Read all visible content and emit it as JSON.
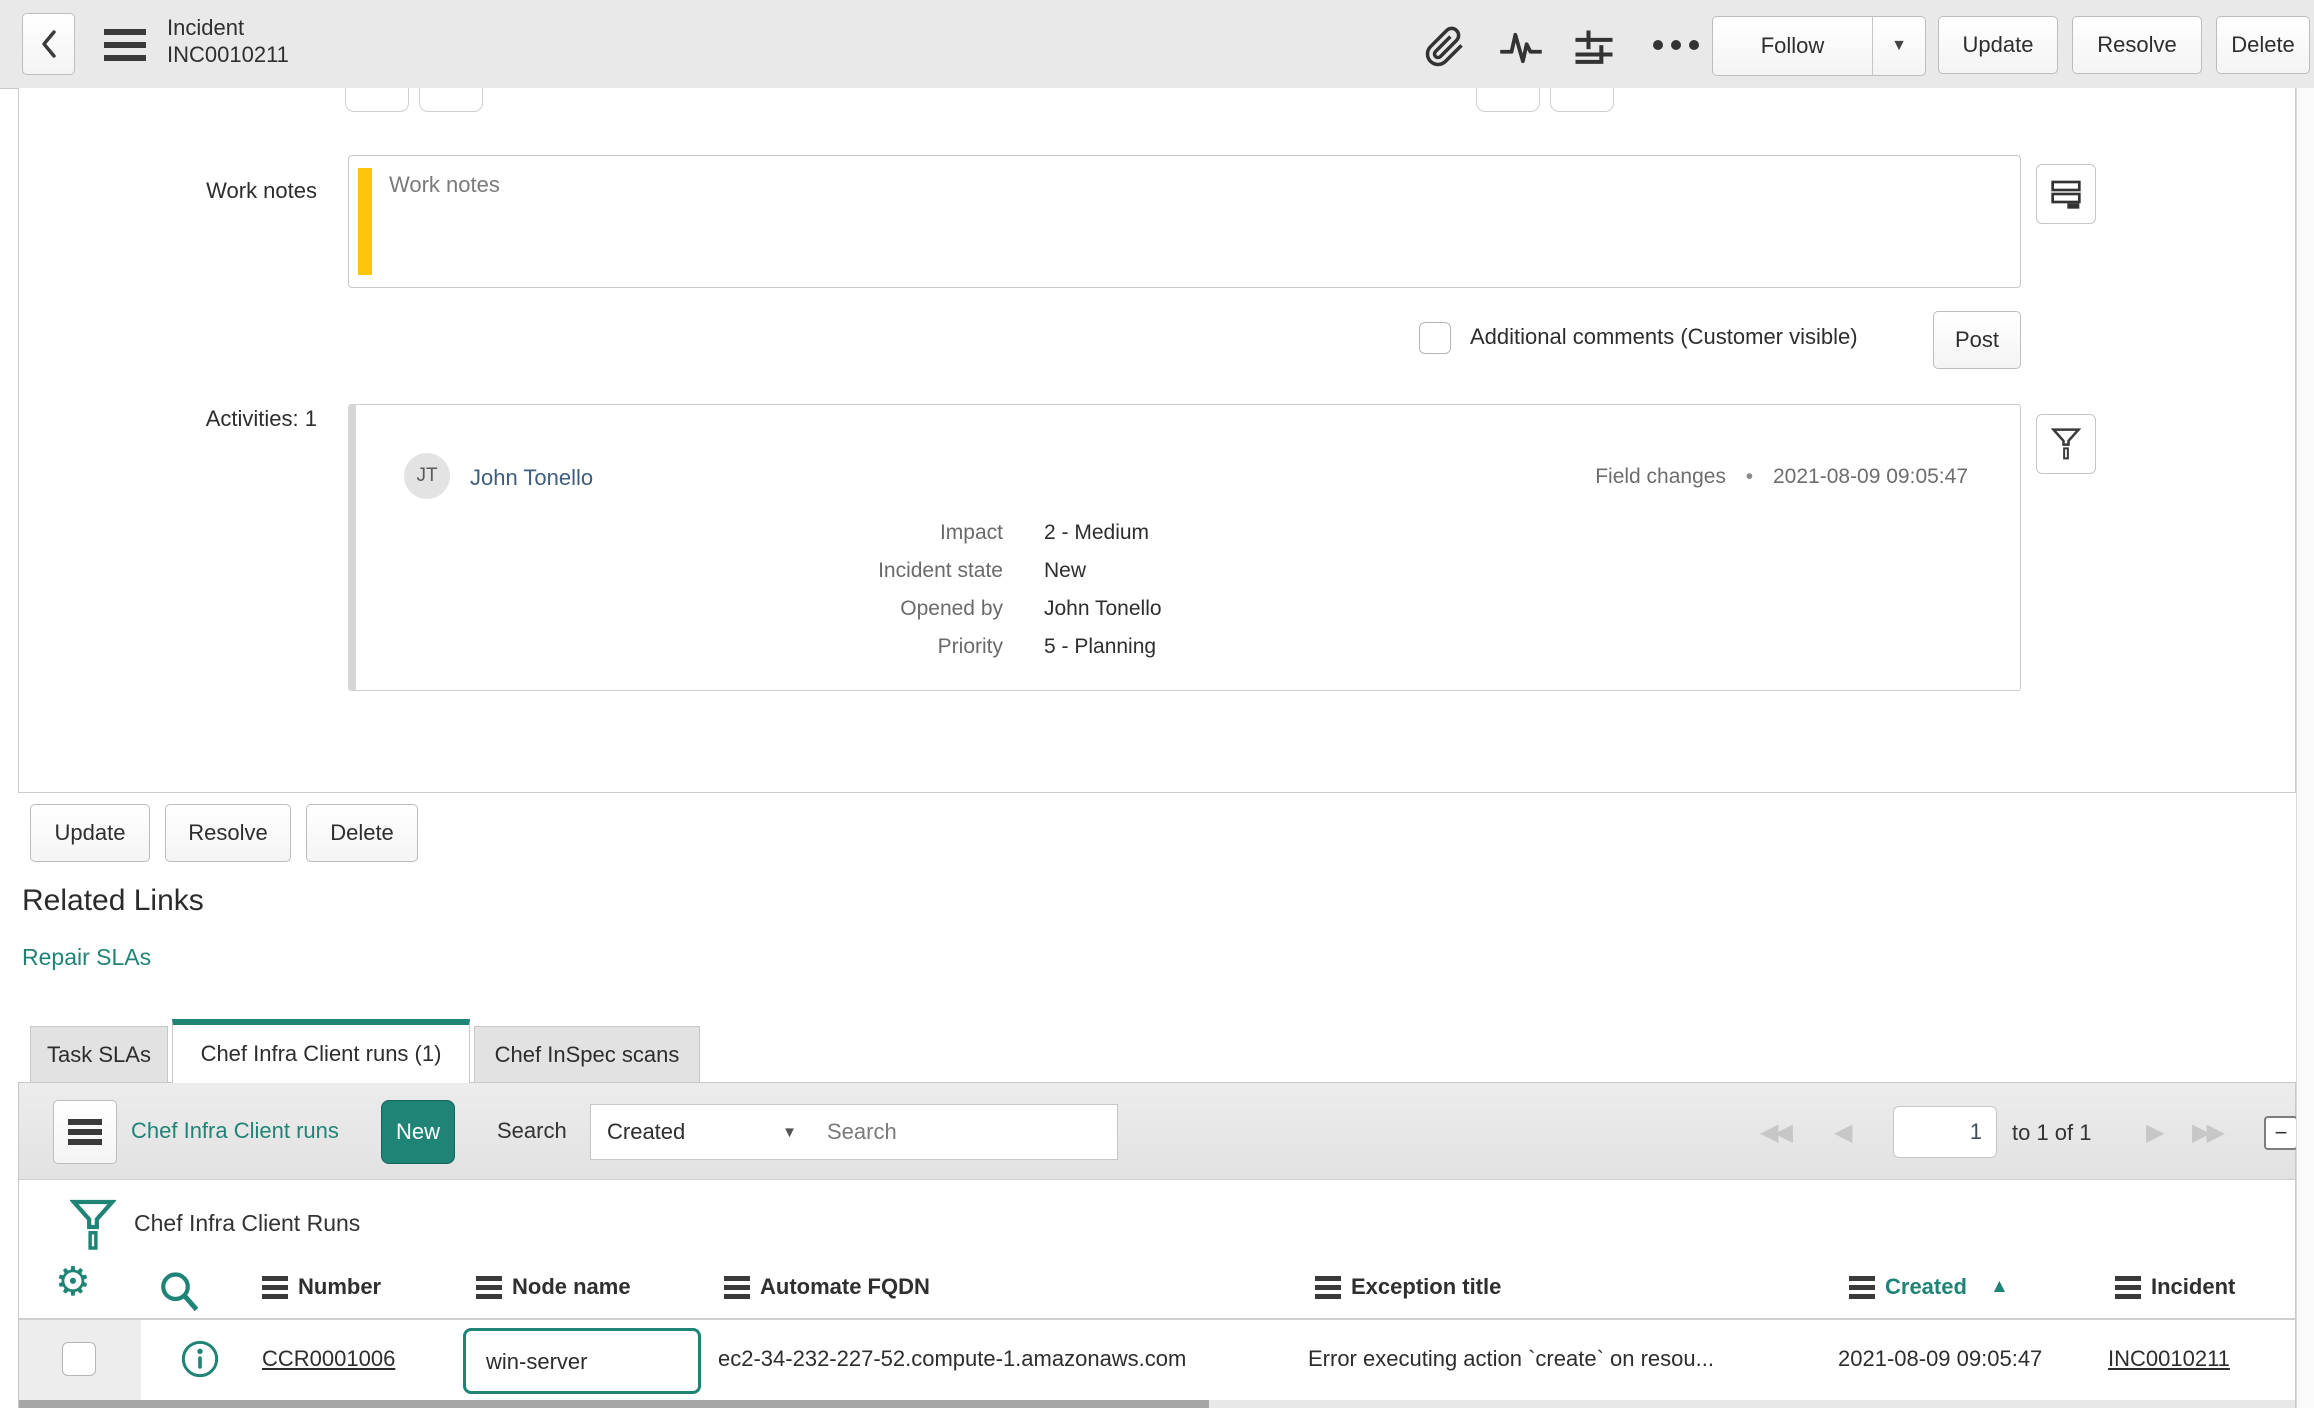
{
  "colors": {
    "accent_teal": "#1f8476",
    "work_notes_bar": "#ffc40c"
  },
  "icons": {
    "gear": "⚙",
    "caret_down": "▼",
    "sort_asc": "▲",
    "bullet": "•",
    "minus": "−",
    "first_page": "◀◀",
    "prev_page": "◀",
    "next_page": "▶",
    "last_page": "▶▶"
  },
  "header": {
    "title_line1": "Incident",
    "title_line2": "INC0010211",
    "follow_label": "Follow",
    "update_label": "Update",
    "resolve_label": "Resolve",
    "delete_label": "Delete"
  },
  "form": {
    "work_notes_label": "Work notes",
    "work_notes_placeholder": "Work notes",
    "additional_comments_label": "Additional comments (Customer visible)",
    "post_label": "Post",
    "activities_label": "Activities: 1",
    "activity": {
      "avatar_initials": "JT",
      "author": "John Tonello",
      "type": "Field changes",
      "timestamp": "2021-08-09 09:05:47",
      "fields": [
        {
          "label": "Impact",
          "value": "2 - Medium"
        },
        {
          "label": "Incident state",
          "value": "New"
        },
        {
          "label": "Opened by",
          "value": "John Tonello"
        },
        {
          "label": "Priority",
          "value": "5 - Planning"
        }
      ]
    }
  },
  "footer_buttons": {
    "update_label": "Update",
    "resolve_label": "Resolve",
    "delete_label": "Delete"
  },
  "related_links": {
    "title": "Related Links",
    "repair_slas": "Repair SLAs"
  },
  "tabs": [
    {
      "label": "Task SLAs"
    },
    {
      "label": "Chef Infra Client runs (1)"
    },
    {
      "label": "Chef InSpec scans"
    }
  ],
  "list": {
    "title_link": "Chef Infra Client runs",
    "new_button": "New",
    "search_label": "Search",
    "search_field_selected": "Created",
    "search_placeholder": "Search",
    "pagination": {
      "page": "1",
      "range": "to 1 of 1"
    },
    "breadcrumb_title": "Chef Infra Client Runs",
    "columns": [
      "Number",
      "Node name",
      "Automate FQDN",
      "Exception title",
      "Created",
      "Incident"
    ],
    "sorted_column": "Created",
    "rows": [
      {
        "number": "CCR0001006",
        "node_name": "win-server",
        "automate_fqdn": "ec2-34-232-227-52.compute-1.amazonaws.com",
        "exception_title": "Error executing action `create` on resou...",
        "created": "2021-08-09 09:05:47",
        "incident": "INC0010211"
      }
    ]
  }
}
